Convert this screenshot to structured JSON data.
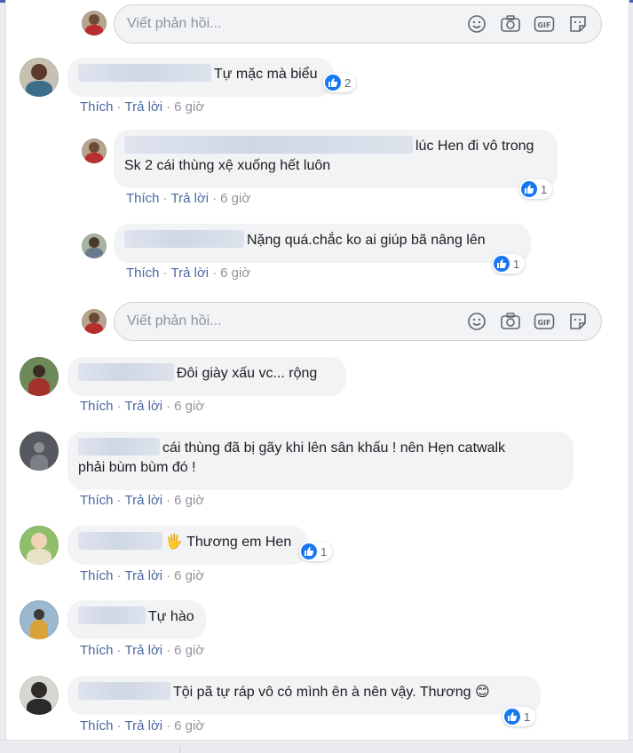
{
  "reply_placeholder": "Viết phản hồi...",
  "actions": {
    "like": "Thích",
    "reply": "Trả lời",
    "separator": "·",
    "time": "6 giờ"
  },
  "icons": [
    "emoji-icon",
    "camera-icon",
    "gif-icon",
    "sticker-icon",
    "like-icon"
  ],
  "colors": {
    "link": "#4b67a1",
    "like_blue": "#1877f2",
    "bubble": "#f2f3f5",
    "muted": "#90949c"
  },
  "comments": [
    {
      "text": "Tự mặc mà biểu",
      "reactions": "2"
    },
    {
      "text_line1": "lúc Hen đi vô trong",
      "text_line2": "Sk 2 cái thùng xệ xuống hết luôn",
      "reactions": "1"
    },
    {
      "text": "Nặng quá.chắc ko ai giúp bã nâng lên",
      "reactions": "1"
    },
    {
      "text": "Đôi giày xấu vc... rộng"
    },
    {
      "text_line1": "cái thùng đã bị gãy khi lên sân khấu ! nên Hẹn catwalk",
      "text_line2": "phải bùm bùm đó !"
    },
    {
      "text": "🖐 Thương em Hen",
      "reactions": "1"
    },
    {
      "text": "Tự hào"
    },
    {
      "text": "Tội pã tự ráp vô có mình ên à nên vậy. Thương 😊",
      "reactions": "1"
    }
  ]
}
